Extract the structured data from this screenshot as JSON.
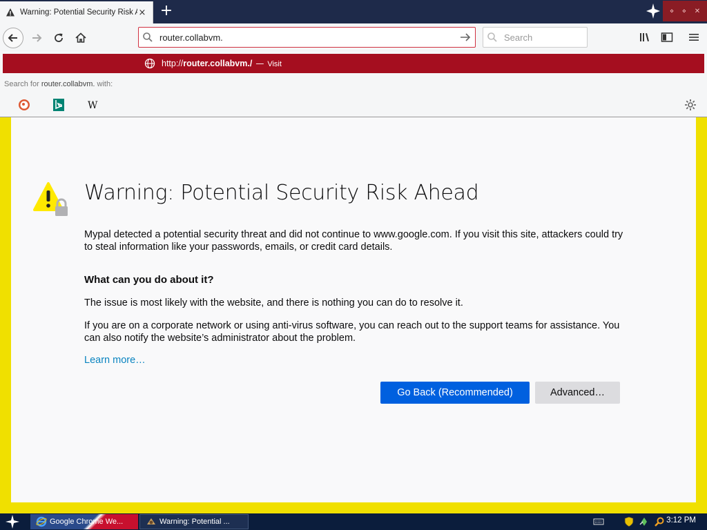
{
  "tab": {
    "title": "Warning: Potential Security Risk Ahead",
    "close": "×"
  },
  "newtab": {
    "label": "+"
  },
  "window_controls": [
    "⋄",
    "⋄",
    "✕"
  ],
  "address": {
    "value": "router.collabvm."
  },
  "search": {
    "placeholder": "Search"
  },
  "popup": {
    "url_prefix": "http://",
    "url_host": "router.collabvm./",
    "dash": "—",
    "visit": "Visit",
    "search_for_prefix": "Search for",
    "search_for_query": "router.collabvm.",
    "search_for_suffix": "with:",
    "engines": [
      "duckduckgo-icon",
      "bing-icon",
      "wikipedia-icon"
    ]
  },
  "page": {
    "title": "Warning: Potential Security Risk Ahead",
    "p1": "Mypal detected a potential security threat and did not continue to www.google.com. If you visit this site, attackers could try to steal information like your passwords, emails, or credit card details.",
    "heading": "What can you do about it?",
    "p2": "The issue is most likely with the website, and there is nothing you can do to resolve it.",
    "p3": "If you are on a corporate network or using anti-virus software, you can reach out to the support teams for assistance. You can also notify the website’s administrator about the problem.",
    "learn_more": "Learn more…",
    "go_back": "Go Back (Recommended)",
    "advanced": "Advanced…"
  },
  "taskbar": {
    "task1": "Google Chrome We...",
    "task2": "Warning: Potential ...",
    "clock": "3:12 PM"
  },
  "colors": {
    "accent": "#0060df",
    "popup_highlight": "#a50e1f",
    "frame": "#f0e000",
    "link": "#0a84c0"
  }
}
